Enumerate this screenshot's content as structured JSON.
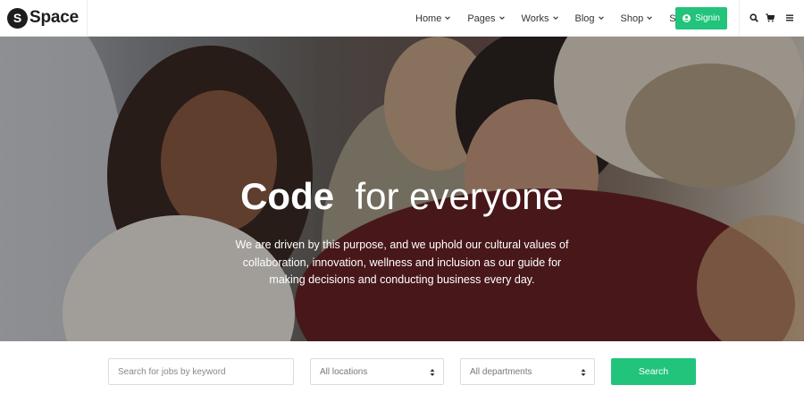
{
  "brand": {
    "logo_letter": "S",
    "name": "Space"
  },
  "nav": {
    "items": [
      {
        "label": "Home",
        "has_dropdown": true
      },
      {
        "label": "Pages",
        "has_dropdown": true
      },
      {
        "label": "Works",
        "has_dropdown": true
      },
      {
        "label": "Blog",
        "has_dropdown": true
      },
      {
        "label": "Shop",
        "has_dropdown": true
      },
      {
        "label": "Starter",
        "has_dropdown": false
      }
    ],
    "signin_label": "Signin",
    "icons": [
      "search-icon",
      "cart-icon",
      "menu-icon"
    ]
  },
  "hero": {
    "title_bold": "Code",
    "title_rest": "for everyone",
    "description": "We are driven by this purpose, and we uphold our cultural values of collaboration, innovation, wellness and inclusion as our guide for making decisions and conducting business every day."
  },
  "search": {
    "keyword_placeholder": "Search for jobs by keyword",
    "location_value": "All locations",
    "department_value": "All departments",
    "button_label": "Search"
  },
  "colors": {
    "accent": "#21c47a",
    "text_dark": "#1d1d1d"
  }
}
